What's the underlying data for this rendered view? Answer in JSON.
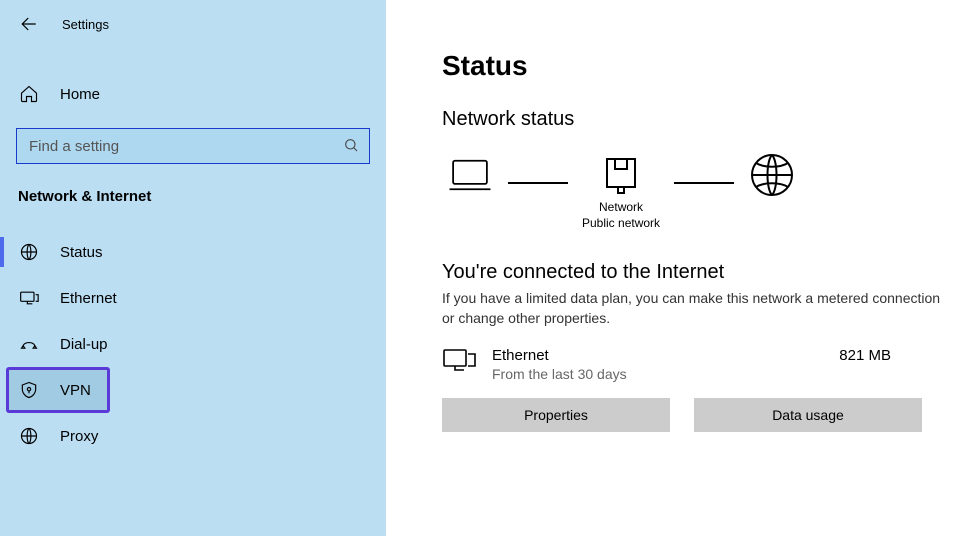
{
  "sidebar": {
    "window_title": "Settings",
    "home_label": "Home",
    "search_placeholder": "Find a setting",
    "group_title": "Network & Internet",
    "items": [
      {
        "label": "Status"
      },
      {
        "label": "Ethernet"
      },
      {
        "label": "Dial-up"
      },
      {
        "label": "VPN"
      },
      {
        "label": "Proxy"
      }
    ]
  },
  "main": {
    "page_title": "Status",
    "section_title": "Network status",
    "diagram": {
      "node_label_1": "Network",
      "node_label_2": "Public network"
    },
    "connected_heading": "You're connected to the Internet",
    "connected_desc": "If you have a limited data plan, you can make this network a metered connection or change other properties.",
    "adapter": {
      "name": "Ethernet",
      "subtext": "From the last 30 days",
      "usage": "821 MB"
    },
    "buttons": {
      "properties": "Properties",
      "data_usage": "Data usage"
    }
  }
}
